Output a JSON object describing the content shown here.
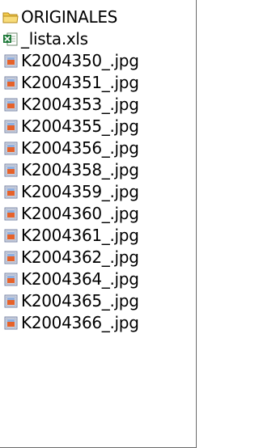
{
  "items": [
    {
      "label": "ORIGINALES",
      "icon": "folder-icon",
      "type": "folder"
    },
    {
      "label": "_lista.xls",
      "icon": "excel-file-icon",
      "type": "xls"
    },
    {
      "label": "K2004350_.jpg",
      "icon": "image-file-icon",
      "type": "jpg"
    },
    {
      "label": "K2004351_.jpg",
      "icon": "image-file-icon",
      "type": "jpg"
    },
    {
      "label": "K2004353_.jpg",
      "icon": "image-file-icon",
      "type": "jpg"
    },
    {
      "label": "K2004355_.jpg",
      "icon": "image-file-icon",
      "type": "jpg"
    },
    {
      "label": "K2004356_.jpg",
      "icon": "image-file-icon",
      "type": "jpg"
    },
    {
      "label": "K2004358_.jpg",
      "icon": "image-file-icon",
      "type": "jpg"
    },
    {
      "label": "K2004359_.jpg",
      "icon": "image-file-icon",
      "type": "jpg"
    },
    {
      "label": "K2004360_.jpg",
      "icon": "image-file-icon",
      "type": "jpg"
    },
    {
      "label": "K2004361_.jpg",
      "icon": "image-file-icon",
      "type": "jpg"
    },
    {
      "label": "K2004362_.jpg",
      "icon": "image-file-icon",
      "type": "jpg"
    },
    {
      "label": "K2004364_.jpg",
      "icon": "image-file-icon",
      "type": "jpg"
    },
    {
      "label": "K2004365_.jpg",
      "icon": "image-file-icon",
      "type": "jpg"
    },
    {
      "label": "K2004366_.jpg",
      "icon": "image-file-icon",
      "type": "jpg"
    }
  ],
  "colors": {
    "folder": "#f2c94c",
    "excel_green": "#1f7a3a",
    "image_frame": "#7a86a6",
    "image_orange": "#e6622a",
    "border": "#6a6a6a"
  }
}
